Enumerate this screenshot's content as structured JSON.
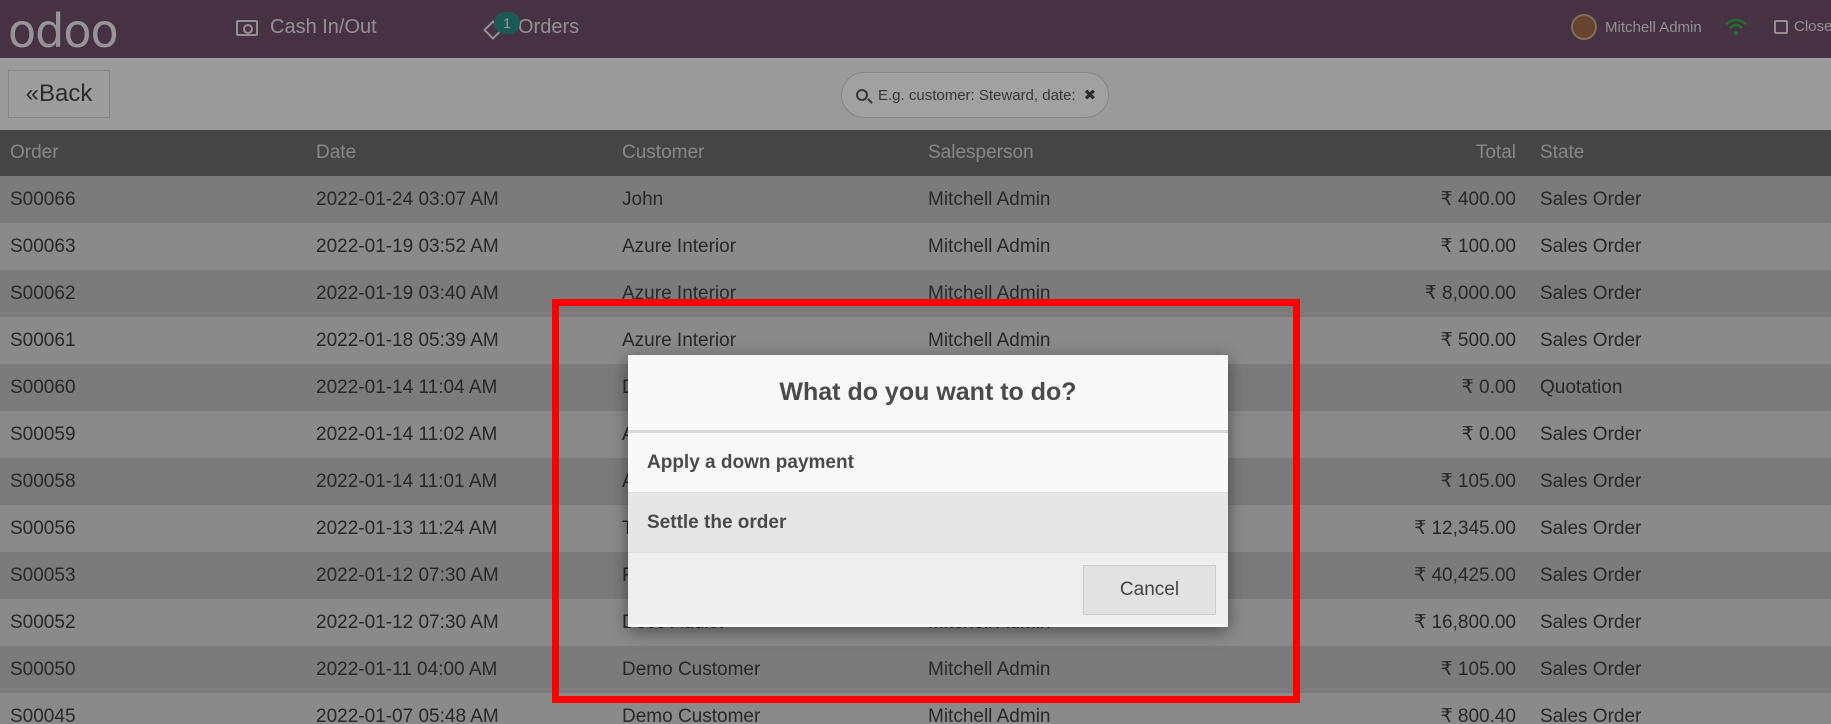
{
  "topbar": {
    "logo": "odoo",
    "cash_label": "Cash In/Out",
    "orders_label": "Orders",
    "orders_badge": "1",
    "user_name": "Mitchell Admin",
    "close_label": "Close"
  },
  "controls": {
    "back_label": "Back",
    "search_placeholder": "E.g. customer: Steward, date:"
  },
  "table": {
    "headers": [
      "Order",
      "Date",
      "Customer",
      "Salesperson",
      "Total",
      "State"
    ],
    "rows": [
      {
        "order": "S00066",
        "date": "2022-01-24 03:07 AM",
        "customer": "John",
        "salesperson": "Mitchell Admin",
        "total": "₹ 400.00",
        "state": "Sales Order"
      },
      {
        "order": "S00063",
        "date": "2022-01-19 03:52 AM",
        "customer": "Azure Interior",
        "salesperson": "Mitchell Admin",
        "total": "₹ 100.00",
        "state": "Sales Order"
      },
      {
        "order": "S00062",
        "date": "2022-01-19 03:40 AM",
        "customer": "Azure Interior",
        "salesperson": "Mitchell Admin",
        "total": "₹ 8,000.00",
        "state": "Sales Order"
      },
      {
        "order": "S00061",
        "date": "2022-01-18 05:39 AM",
        "customer": "Azure Interior",
        "salesperson": "Mitchell Admin",
        "total": "₹ 500.00",
        "state": "Sales Order"
      },
      {
        "order": "S00060",
        "date": "2022-01-14 11:04 AM",
        "customer": "D",
        "salesperson": "",
        "total": "₹ 0.00",
        "state": "Quotation"
      },
      {
        "order": "S00059",
        "date": "2022-01-14 11:02 AM",
        "customer": "A",
        "salesperson": "",
        "total": "₹ 0.00",
        "state": "Sales Order"
      },
      {
        "order": "S00058",
        "date": "2022-01-14 11:01 AM",
        "customer": "A",
        "salesperson": "",
        "total": "₹ 105.00",
        "state": "Sales Order"
      },
      {
        "order": "S00056",
        "date": "2022-01-13 11:24 AM",
        "customer": "T",
        "salesperson": "",
        "total": "₹ 12,345.00",
        "state": "Sales Order"
      },
      {
        "order": "S00053",
        "date": "2022-01-12 07:30 AM",
        "customer": "F",
        "salesperson": "",
        "total": "₹ 40,425.00",
        "state": "Sales Order"
      },
      {
        "order": "S00052",
        "date": "2022-01-12 07:30 AM",
        "customer": "Deco Addict",
        "salesperson": "Mitchell Admin",
        "total": "₹ 16,800.00",
        "state": "Sales Order"
      },
      {
        "order": "S00050",
        "date": "2022-01-11 04:00 AM",
        "customer": "Demo Customer",
        "salesperson": "Mitchell Admin",
        "total": "₹ 105.00",
        "state": "Sales Order"
      },
      {
        "order": "S00045",
        "date": "2022-01-07 05:48 AM",
        "customer": "Demo Customer",
        "salesperson": "Mitchell Admin",
        "total": "₹ 800.40",
        "state": "Sales Order"
      }
    ]
  },
  "dialog": {
    "title": "What do you want to do?",
    "options": [
      "Apply a down payment",
      "Settle the order"
    ],
    "cancel_label": "Cancel"
  },
  "colors": {
    "topbar": "#6e4e69",
    "badge": "#2a8a82",
    "highlight": "#ff0000"
  }
}
